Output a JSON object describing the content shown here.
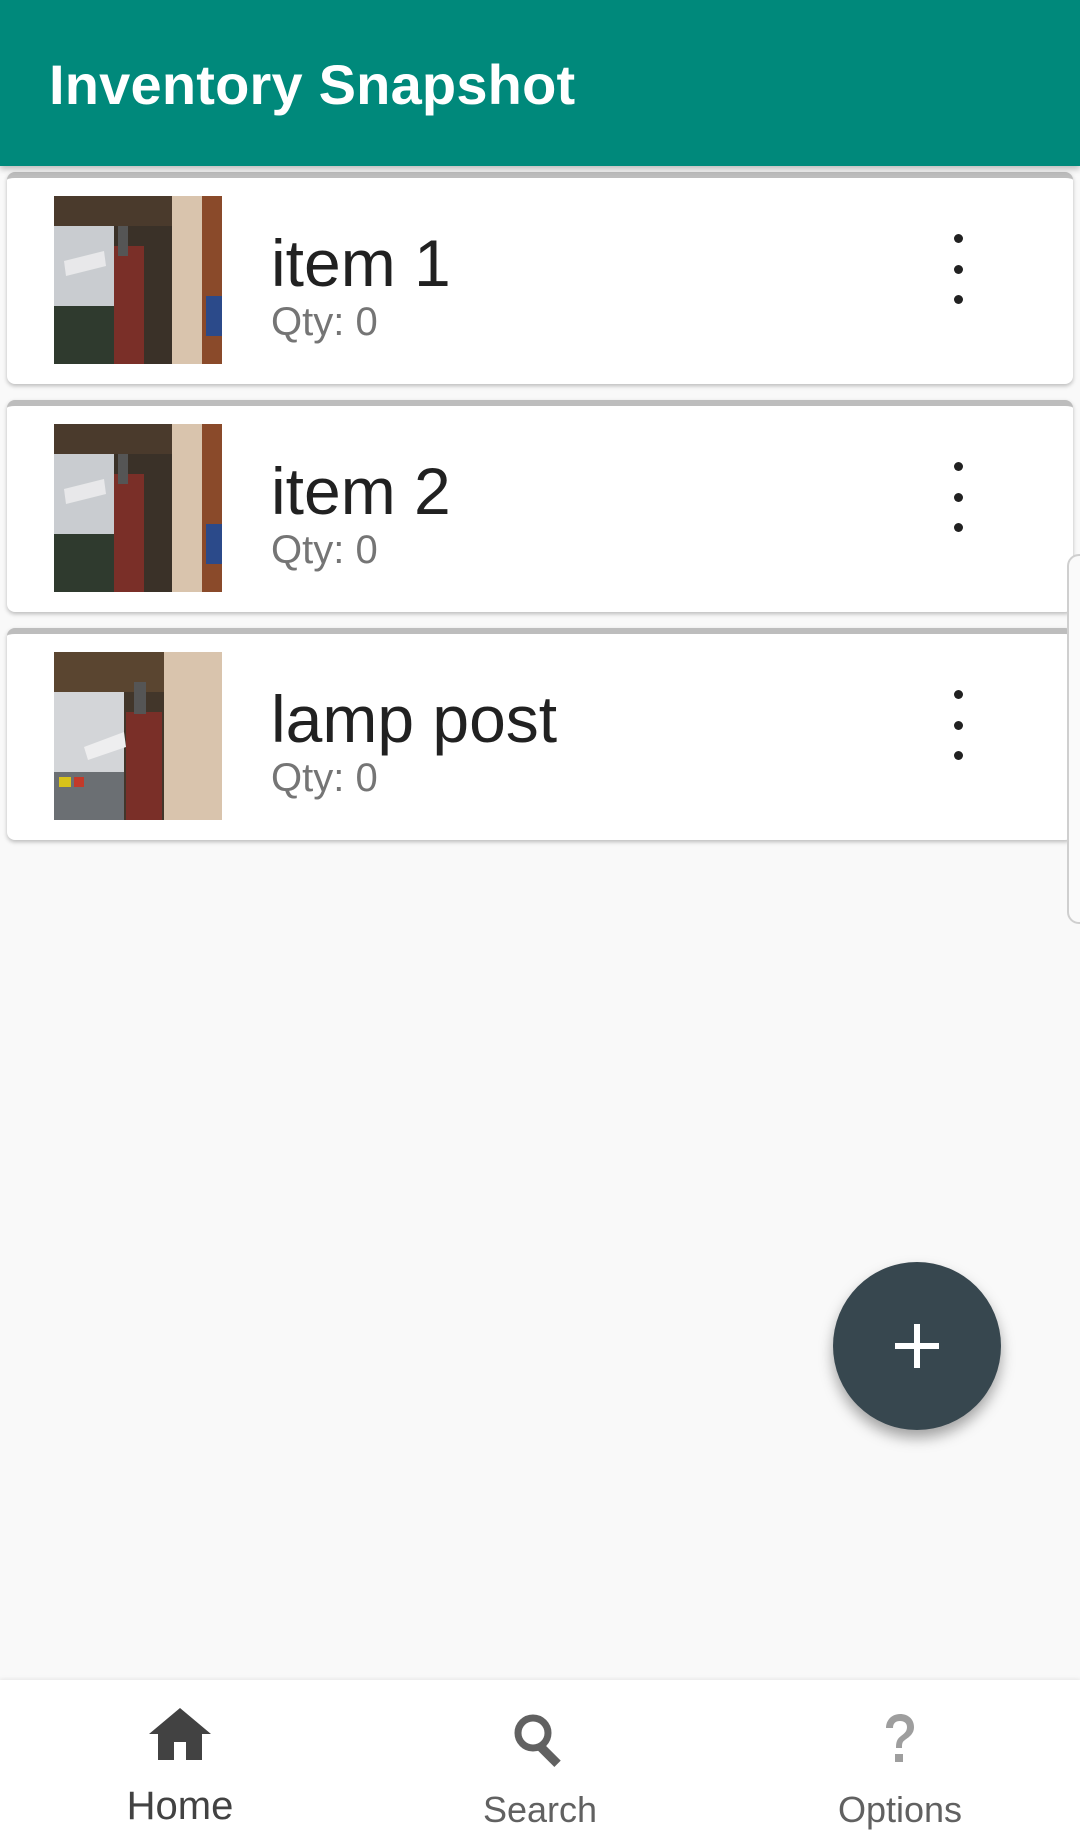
{
  "app_bar": {
    "title": "Inventory Snapshot",
    "color": "#00897b"
  },
  "items": [
    {
      "name": "item 1",
      "qty": "Qty: 0",
      "thumbnail_icon": "photo-thumbnail"
    },
    {
      "name": "item 2",
      "qty": "Qty: 0",
      "thumbnail_icon": "photo-thumbnail"
    },
    {
      "name": "lamp post",
      "qty": "Qty: 0",
      "thumbnail_icon": "photo-thumbnail"
    }
  ],
  "fab": {
    "icon": "plus-icon",
    "color": "#37474f"
  },
  "bottom_nav": {
    "items": [
      {
        "label": "Home",
        "icon": "home-icon",
        "active": true
      },
      {
        "label": "Search",
        "icon": "search-icon",
        "active": false
      },
      {
        "label": "Options",
        "icon": "help-icon",
        "active": false
      }
    ]
  }
}
